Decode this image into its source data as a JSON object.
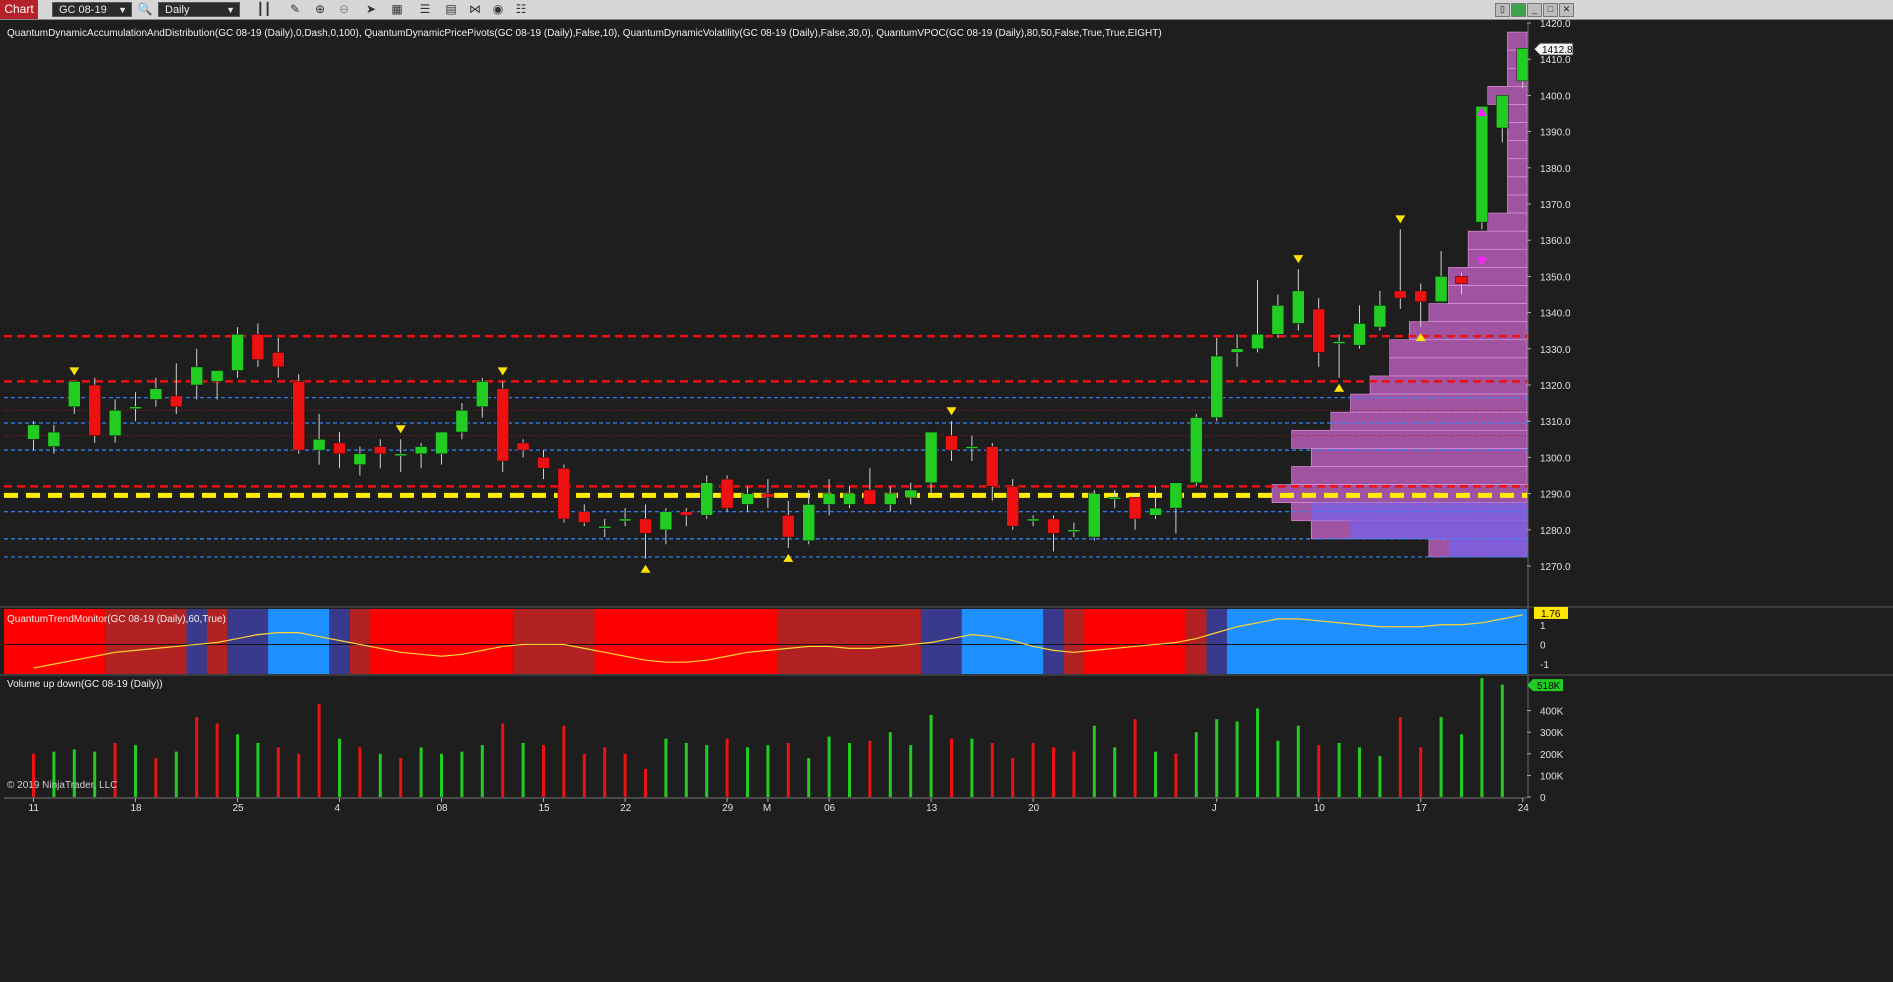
{
  "toolbar": {
    "title": "Chart",
    "instrument": "GC 08-19",
    "period": "Daily"
  },
  "indicator_labels": {
    "main": "QuantumDynamicAccumulationAndDistribution(GC 08-19 (Daily),0,Dash,0,100), QuantumDynamicPricePivots(GC 08-19 (Daily),False,10), QuantumDynamicVolatility(GC 08-19 (Daily),False,30,0), QuantumVPOC(GC 08-19 (Daily),80,50,False,True,True,EIGHT)",
    "trend": "QuantumTrendMonitor(GC 08-19 (Daily),60,True)",
    "volume": "Volume up down(GC 08-19 (Daily))"
  },
  "copyright": "© 2019 NinjaTrader, LLC",
  "colors": {
    "up": "#22cc22",
    "down": "#ee1111",
    "background": "#1e1e1e",
    "vpoc": "#cc66cc",
    "poc_line": "#ffee00",
    "resistance": "#ee1111",
    "support": "#3388ff",
    "trend_strong_bear": "#ff0000",
    "trend_weak_bear": "#b22222",
    "trend_transition": "#3a3a8c",
    "trend_bull": "#1e90ff"
  },
  "chart_data": [
    {
      "type": "candlestick",
      "price_axis": {
        "ylim": [
          1265,
          1425
        ],
        "ticks": [
          1270,
          1280,
          1290,
          1300,
          1310,
          1320,
          1330,
          1340,
          1350,
          1360,
          1370,
          1380,
          1390,
          1400,
          1410,
          1420
        ]
      },
      "last_price_label": "1412.8",
      "x_labels": [
        "11",
        "18",
        "25",
        "4",
        "08",
        "15",
        "22",
        "29",
        "M",
        "06",
        "13",
        "20",
        "J",
        "10",
        "17",
        "24"
      ],
      "candles": [
        [
          1305,
          1310,
          1302,
          1309
        ],
        [
          1303,
          1309,
          1301,
          1307
        ],
        [
          1314,
          1321,
          1312,
          1321
        ],
        [
          1320,
          1322,
          1304,
          1306
        ],
        [
          1306,
          1316,
          1304,
          1313
        ],
        [
          1314,
          1318,
          1310,
          1314
        ],
        [
          1316,
          1322,
          1314,
          1319
        ],
        [
          1317,
          1326,
          1312,
          1314
        ],
        [
          1320,
          1330,
          1316,
          1325
        ],
        [
          1321,
          1324,
          1316,
          1324
        ],
        [
          1324,
          1336,
          1322,
          1334
        ],
        [
          1334,
          1337,
          1325,
          1327
        ],
        [
          1329,
          1333,
          1322,
          1325
        ],
        [
          1321,
          1323,
          1301,
          1302
        ],
        [
          1302,
          1312,
          1298,
          1305
        ],
        [
          1304,
          1307,
          1297,
          1301
        ],
        [
          1298,
          1303,
          1295,
          1301
        ],
        [
          1303,
          1305,
          1297,
          1301
        ],
        [
          1301,
          1305,
          1296,
          1301
        ],
        [
          1301,
          1304,
          1297,
          1303
        ],
        [
          1301,
          1307,
          1298,
          1307
        ],
        [
          1307,
          1315,
          1305,
          1313
        ],
        [
          1314,
          1322,
          1311,
          1321
        ],
        [
          1319,
          1321,
          1296,
          1299
        ],
        [
          1304,
          1305,
          1300,
          1302
        ],
        [
          1300,
          1302,
          1294,
          1297
        ],
        [
          1297,
          1298,
          1282,
          1283
        ],
        [
          1285,
          1287,
          1281,
          1282
        ],
        [
          1281,
          1283,
          1278,
          1281
        ],
        [
          1283,
          1286,
          1281,
          1283
        ],
        [
          1283,
          1287,
          1272,
          1279
        ],
        [
          1280,
          1286,
          1276,
          1285
        ],
        [
          1285,
          1286,
          1281,
          1284
        ],
        [
          1284,
          1295,
          1283,
          1293
        ],
        [
          1294,
          1295,
          1285,
          1286
        ],
        [
          1287,
          1292,
          1285,
          1290
        ],
        [
          1290,
          1294,
          1286,
          1289
        ],
        [
          1284,
          1288,
          1275,
          1278
        ],
        [
          1277,
          1291,
          1276,
          1287
        ],
        [
          1287,
          1294,
          1284,
          1290
        ],
        [
          1287,
          1292,
          1286,
          1290
        ],
        [
          1291,
          1297,
          1288,
          1287
        ],
        [
          1287,
          1292,
          1285,
          1290
        ],
        [
          1289,
          1293,
          1287,
          1291
        ],
        [
          1293,
          1307,
          1290,
          1307
        ],
        [
          1306,
          1310,
          1299,
          1302
        ],
        [
          1303,
          1306,
          1299,
          1303
        ],
        [
          1303,
          1304,
          1288,
          1292
        ],
        [
          1292,
          1294,
          1280,
          1281
        ],
        [
          1283,
          1284,
          1281,
          1283
        ],
        [
          1283,
          1284,
          1274,
          1279
        ],
        [
          1280,
          1282,
          1278,
          1280
        ],
        [
          1278,
          1291,
          1277,
          1290
        ],
        [
          1289,
          1291,
          1286,
          1289
        ],
        [
          1289,
          1290,
          1280,
          1283
        ],
        [
          1284,
          1292,
          1283,
          1286
        ],
        [
          1286,
          1293,
          1279,
          1293
        ],
        [
          1293,
          1312,
          1292,
          1311
        ],
        [
          1311,
          1333,
          1310,
          1328
        ],
        [
          1329,
          1334,
          1325,
          1330
        ],
        [
          1330,
          1349,
          1329,
          1334
        ],
        [
          1334,
          1345,
          1333,
          1342
        ],
        [
          1337,
          1352,
          1335,
          1346
        ],
        [
          1341,
          1344,
          1325,
          1329
        ],
        [
          1332,
          1334,
          1322,
          1332
        ],
        [
          1331,
          1342,
          1330,
          1337
        ],
        [
          1336,
          1346,
          1335,
          1342
        ],
        [
          1346,
          1363,
          1341,
          1344
        ],
        [
          1346,
          1348,
          1336,
          1343
        ],
        [
          1343,
          1357,
          1343,
          1350
        ],
        [
          1350,
          1351,
          1345,
          1348
        ],
        [
          1365,
          1397,
          1363,
          1397
        ],
        [
          1391,
          1400,
          1387,
          1400
        ],
        [
          1404,
          1413,
          1402,
          1413
        ]
      ],
      "horizontal_levels": [
        {
          "price": 1333.5,
          "style": "red-dash"
        },
        {
          "price": 1321.0,
          "style": "red-dash"
        },
        {
          "price": 1292.0,
          "style": "red-dash"
        },
        {
          "price": 1289.5,
          "style": "yellow-dash"
        },
        {
          "price": 1316.5,
          "style": "blue-dash"
        },
        {
          "price": 1309.5,
          "style": "blue-dash"
        },
        {
          "price": 1302.0,
          "style": "blue-dash"
        },
        {
          "price": 1285.0,
          "style": "blue-dash"
        },
        {
          "price": 1277.5,
          "style": "blue-dash"
        },
        {
          "price": 1272.5,
          "style": "blue-dash"
        },
        {
          "price": 1313.0,
          "style": "thin-red"
        },
        {
          "price": 1306.0,
          "style": "thin-red"
        }
      ],
      "pivots": [
        {
          "bar": 2,
          "dir": "down"
        },
        {
          "bar": 18,
          "dir": "down"
        },
        {
          "bar": 23,
          "dir": "down"
        },
        {
          "bar": 30,
          "dir": "up"
        },
        {
          "bar": 37,
          "dir": "up"
        },
        {
          "bar": 45,
          "dir": "down"
        },
        {
          "bar": 62,
          "dir": "down"
        },
        {
          "bar": 64,
          "dir": "up"
        },
        {
          "bar": 67,
          "dir": "down"
        },
        {
          "bar": 68,
          "dir": "up"
        }
      ],
      "vpoc_profile": [
        [
          1415,
          1
        ],
        [
          1410,
          1
        ],
        [
          1405,
          1
        ],
        [
          1400,
          2
        ],
        [
          1395,
          1
        ],
        [
          1390,
          1
        ],
        [
          1385,
          1
        ],
        [
          1380,
          1
        ],
        [
          1375,
          1
        ],
        [
          1370,
          1
        ],
        [
          1365,
          2
        ],
        [
          1360,
          3
        ],
        [
          1355,
          3
        ],
        [
          1350,
          4
        ],
        [
          1345,
          4
        ],
        [
          1340,
          5
        ],
        [
          1335,
          6
        ],
        [
          1330,
          7
        ],
        [
          1325,
          7
        ],
        [
          1320,
          8
        ],
        [
          1315,
          9
        ],
        [
          1310,
          10
        ],
        [
          1305,
          12
        ],
        [
          1300,
          11
        ],
        [
          1295,
          12
        ],
        [
          1290,
          13
        ],
        [
          1285,
          12
        ],
        [
          1280,
          11
        ],
        [
          1275,
          5
        ]
      ]
    },
    {
      "type": "area",
      "name": "QuantumTrendMonitor",
      "axis_ticks": [
        "1",
        "0",
        "-1"
      ],
      "last_value_label": "1.76",
      "ylim": [
        -1.5,
        1.8
      ],
      "values": [
        -1.2,
        -1.0,
        -0.8,
        -0.6,
        -0.4,
        -0.3,
        -0.2,
        -0.1,
        0.0,
        0.1,
        0.3,
        0.5,
        0.6,
        0.6,
        0.4,
        0.2,
        0.0,
        -0.2,
        -0.4,
        -0.5,
        -0.6,
        -0.5,
        -0.3,
        -0.1,
        0.0,
        0.0,
        0.0,
        -0.2,
        -0.4,
        -0.6,
        -0.8,
        -0.9,
        -0.9,
        -0.8,
        -0.6,
        -0.4,
        -0.3,
        -0.2,
        -0.1,
        -0.1,
        -0.2,
        -0.2,
        -0.1,
        0.0,
        0.1,
        0.3,
        0.5,
        0.4,
        0.2,
        -0.1,
        -0.3,
        -0.4,
        -0.3,
        -0.2,
        -0.1,
        0.0,
        0.1,
        0.3,
        0.6,
        0.9,
        1.1,
        1.3,
        1.3,
        1.2,
        1.1,
        1.0,
        0.9,
        0.9,
        0.9,
        1.0,
        1.0,
        1.1,
        1.3,
        1.5
      ],
      "color_segments": [
        [
          0,
          4,
          "trend_strong_bear"
        ],
        [
          4,
          8,
          "trend_weak_bear"
        ],
        [
          8,
          9,
          "trend_transition"
        ],
        [
          9,
          10,
          "trend_weak_bear"
        ],
        [
          10,
          12,
          "trend_transition"
        ],
        [
          12,
          15,
          "trend_bull"
        ],
        [
          15,
          16,
          "trend_transition"
        ],
        [
          16,
          17,
          "trend_weak_bear"
        ],
        [
          17,
          24,
          "trend_strong_bear"
        ],
        [
          24,
          28,
          "trend_weak_bear"
        ],
        [
          28,
          37,
          "trend_strong_bear"
        ],
        [
          37,
          44,
          "trend_weak_bear"
        ],
        [
          44,
          46,
          "trend_transition"
        ],
        [
          46,
          50,
          "trend_bull"
        ],
        [
          50,
          51,
          "trend_transition"
        ],
        [
          51,
          52,
          "trend_weak_bear"
        ],
        [
          52,
          57,
          "trend_strong_bear"
        ],
        [
          57,
          58,
          "trend_weak_bear"
        ],
        [
          58,
          59,
          "trend_transition"
        ],
        [
          59,
          74,
          "trend_bull"
        ]
      ]
    },
    {
      "type": "bar",
      "name": "Volume up down",
      "axis_ticks": [
        "400K",
        "300K",
        "200K",
        "100K",
        "0"
      ],
      "last_value_label": "518K",
      "ylim": [
        0,
        560
      ],
      "values": [
        200,
        210,
        220,
        210,
        250,
        240,
        180,
        210,
        370,
        340,
        290,
        250,
        230,
        200,
        430,
        270,
        230,
        200,
        180,
        230,
        200,
        210,
        240,
        340,
        250,
        240,
        330,
        200,
        230,
        200,
        130,
        270,
        250,
        240,
        270,
        230,
        240,
        250,
        180,
        280,
        250,
        260,
        300,
        240,
        380,
        270,
        270,
        250,
        180,
        250,
        230,
        210,
        330,
        230,
        360,
        210,
        200,
        300,
        360,
        350,
        410,
        260,
        330,
        240,
        250,
        230,
        190,
        370,
        230,
        370,
        290,
        550,
        520
      ],
      "directions": [
        "d",
        "u",
        "u",
        "u",
        "d",
        "u",
        "d",
        "u",
        "d",
        "d",
        "u",
        "u",
        "d",
        "d",
        "d",
        "u",
        "d",
        "u",
        "d",
        "u",
        "u",
        "u",
        "u",
        "d",
        "u",
        "d",
        "d",
        "d",
        "d",
        "d",
        "d",
        "u",
        "u",
        "u",
        "d",
        "u",
        "u",
        "d",
        "u",
        "u",
        "u",
        "d",
        "u",
        "u",
        "u",
        "d",
        "u",
        "d",
        "d",
        "d",
        "d",
        "d",
        "u",
        "u",
        "d",
        "u",
        "d",
        "u",
        "u",
        "u",
        "u",
        "u",
        "u",
        "d",
        "u",
        "u",
        "u",
        "d",
        "d",
        "u",
        "u",
        "u",
        "u",
        "u"
      ]
    }
  ]
}
